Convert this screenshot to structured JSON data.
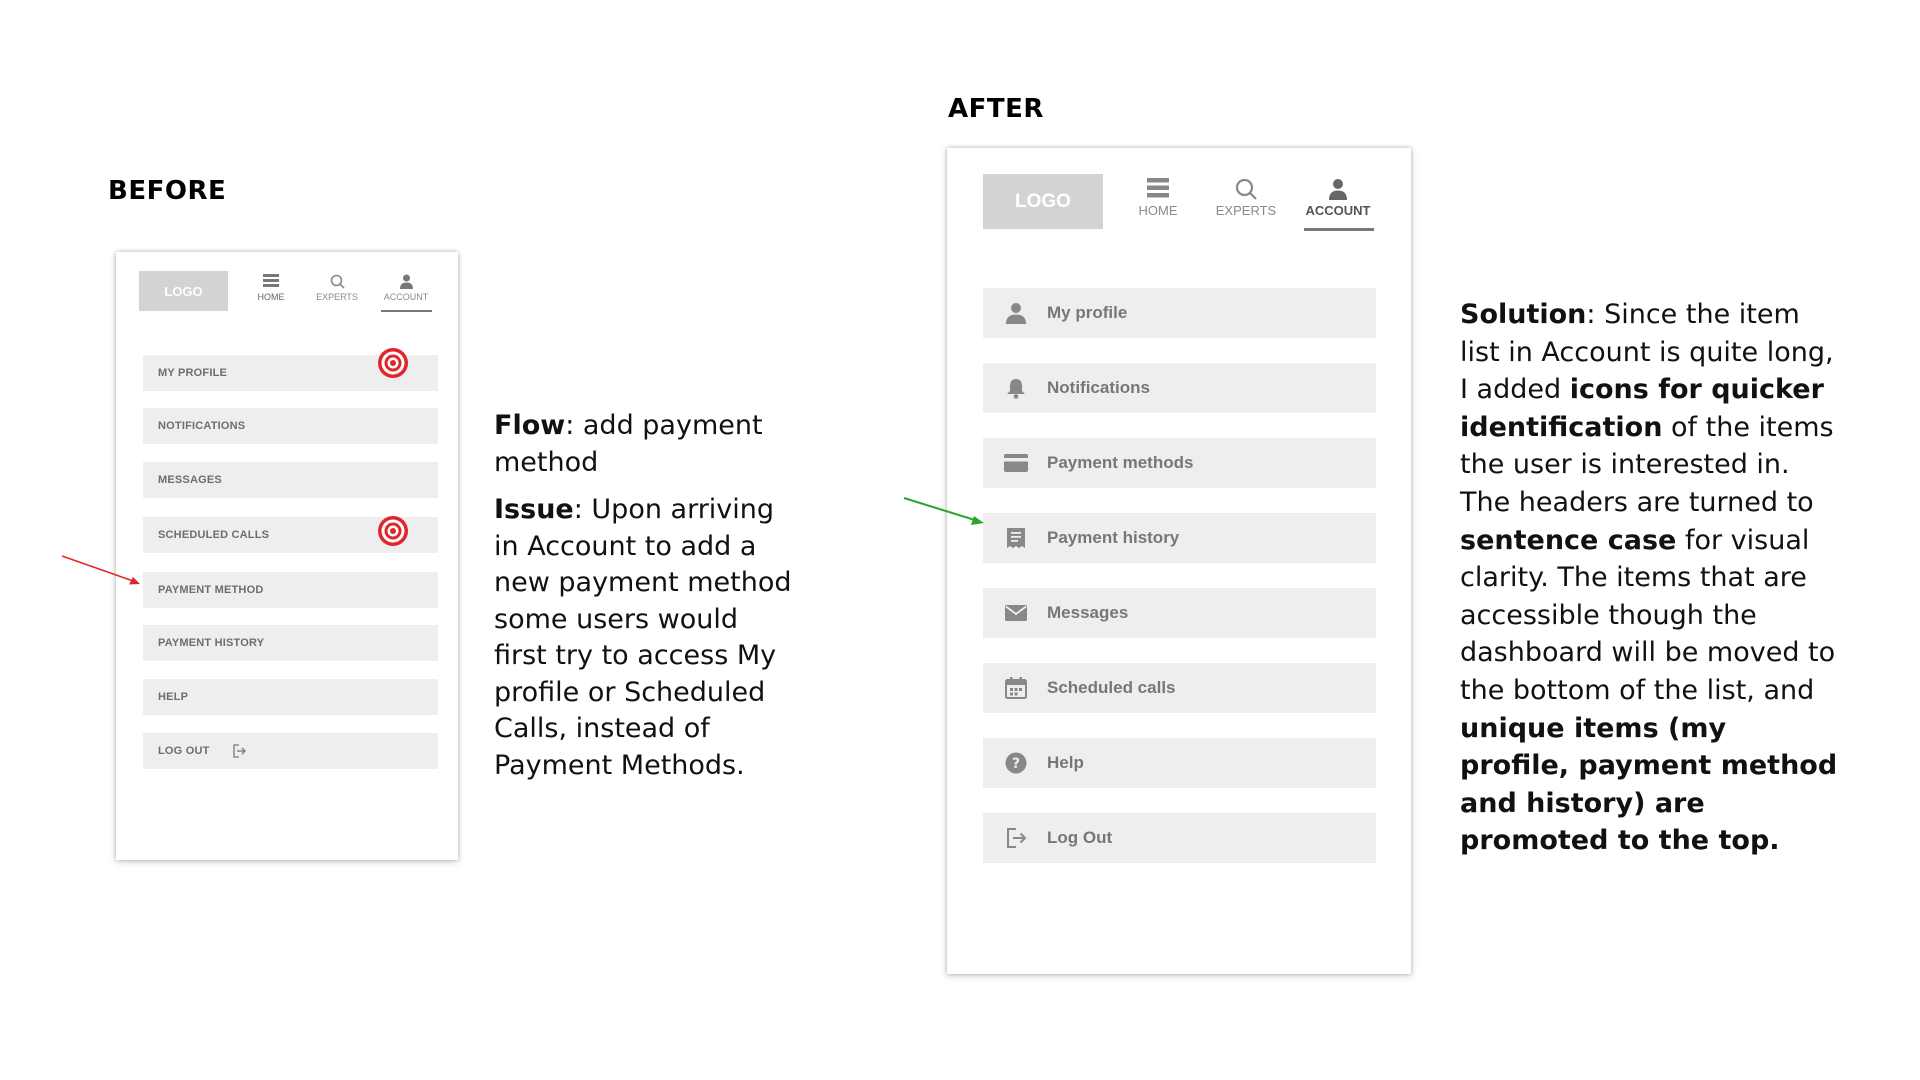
{
  "before": {
    "heading": "BEFORE",
    "logo": "LOGO",
    "nav": {
      "home": "HOME",
      "experts": "EXPERTS",
      "account": "ACCOUNT"
    },
    "items": [
      "MY PROFILE",
      "NOTIFICATIONS",
      "MESSAGES",
      "SCHEDULED CALLS",
      "PAYMENT METHOD",
      "PAYMENT HISTORY",
      "HELP",
      "LOG OUT"
    ]
  },
  "after": {
    "heading": "AFTER",
    "logo": "LOGO",
    "nav": {
      "home": "HOME",
      "experts": "EXPERTS",
      "account": "ACCOUNT"
    },
    "items": [
      "My profile",
      "Notifications",
      "Payment methods",
      "Payment history",
      "Messages",
      "Scheduled calls",
      "Help",
      "Log Out"
    ]
  },
  "flow": {
    "label": "Flow",
    "text": ":  add  payment method"
  },
  "issue": {
    "label": "Issue",
    "text": ": Upon arriving in Account to add a new payment method some users would first try to access My profile or Scheduled Calls, instead of Payment Methods."
  },
  "solution": {
    "label": "Solution",
    "t1": ": Since the item list in Account is quite long, I added ",
    "b1": "icons for quicker identification",
    "t2": " of the items the user is interested in. The headers are turned to ",
    "b2": "sentence case",
    "t3": " for visual clarity. The items that are accessible though the dashboard will be moved to the bottom of the list, and ",
    "b3": "unique items (my profile, payment method and history) are promoted to the top."
  },
  "colors": {
    "target_red": "#e0252b",
    "arrow_red": "#e0252b",
    "arrow_green": "#2aa52a",
    "item_bg": "#eeeeee",
    "logo_bg": "#d3d3d3"
  }
}
